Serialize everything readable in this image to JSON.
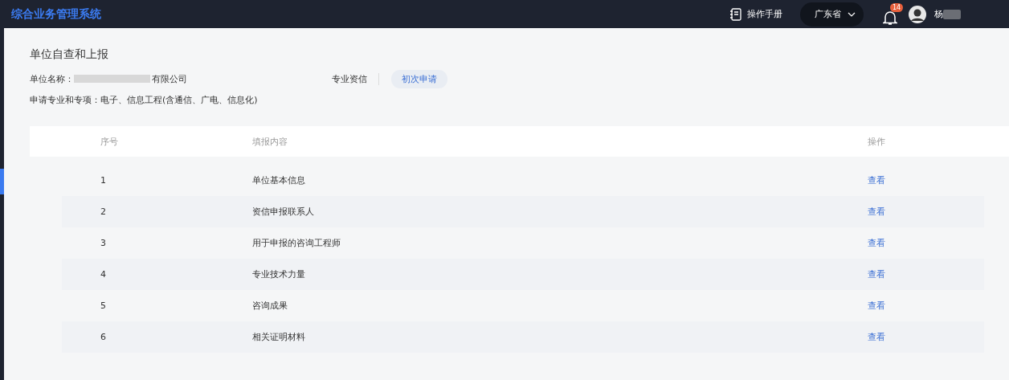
{
  "header": {
    "app_title": "综合业务管理系统",
    "manual": "操作手册",
    "region": "广东省",
    "notifications": "14",
    "user": "杨"
  },
  "sidebar": {
    "items": [
      {
        "selected": true
      }
    ]
  },
  "page": {
    "title": "单位自查和上报",
    "unit_label": "单位名称：",
    "unit_name": "有限公司",
    "qualification": "专业资信",
    "apply_type": "初次申请",
    "major_label": "申请专业和专项：",
    "major": "电子、信息工程(含通信、广电、信息化)"
  },
  "table": {
    "columns": [
      "序号",
      "填报内容",
      "操作"
    ],
    "rows": [
      {
        "no": "1",
        "content": "单位基本信息",
        "action": "查看"
      },
      {
        "no": "2",
        "content": "资信申报联系人",
        "action": "查看"
      },
      {
        "no": "3",
        "content": "用于申报的咨询工程师",
        "action": "查看"
      },
      {
        "no": "4",
        "content": "专业技术力量",
        "action": "查看"
      },
      {
        "no": "5",
        "content": "咨询成果",
        "action": "查看"
      },
      {
        "no": "6",
        "content": "相关证明材料",
        "action": "查看"
      }
    ]
  }
}
